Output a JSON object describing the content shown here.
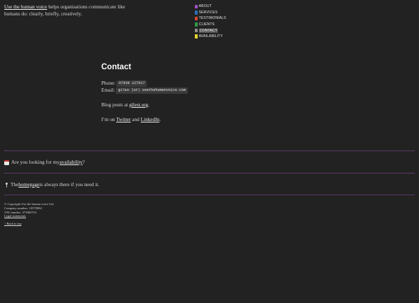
{
  "intro": {
    "link_text": "Use the human voice",
    "rest_line1": " helps organisations communicate like",
    "rest_line2": "humans do: clearly, briefly, creatively."
  },
  "nav": {
    "items": [
      {
        "label": "About",
        "color": "#9b4fc4",
        "current": false
      },
      {
        "label": "Services",
        "color": "#2a6fb5",
        "current": false
      },
      {
        "label": "Testimonials",
        "color": "#d8462f",
        "current": false
      },
      {
        "label": "Clients",
        "color": "#2e9a44",
        "current": false
      },
      {
        "label": "Contact",
        "color": "#8d8d8d",
        "current": true
      },
      {
        "label": "Availability",
        "color": "#e3d62b",
        "current": false
      }
    ]
  },
  "contact": {
    "title": "Contact",
    "phone_label": "Phone:",
    "phone_value": "07939 127917",
    "email_label": "Email:",
    "email_value": "giles (at) usethehumanvoice.com",
    "blog_prefix": "Blog posts at ",
    "blog_link": "gilest.org",
    "blog_suffix": ".",
    "social_prefix": "I’m on ",
    "twitter_link": "Twitter",
    "social_and": " and ",
    "linkedin_link": "LinkedIn",
    "social_suffix": "."
  },
  "availability_callout": {
    "prefix": "Are you looking for my ",
    "link": "availability",
    "suffix": "?"
  },
  "homepage_callout": {
    "prefix": "The ",
    "link": "homepage",
    "suffix": " is always there if you need it."
  },
  "footer": {
    "copyright": "© Copyright Use the human voice Ltd",
    "company": "Company number: 10570984",
    "vat": "VAT number: 279300752",
    "legal_link": "Legal statements",
    "back_link": "↑ Back to top"
  },
  "colors": {
    "background": "#222222",
    "rule": "#5a3a66"
  }
}
